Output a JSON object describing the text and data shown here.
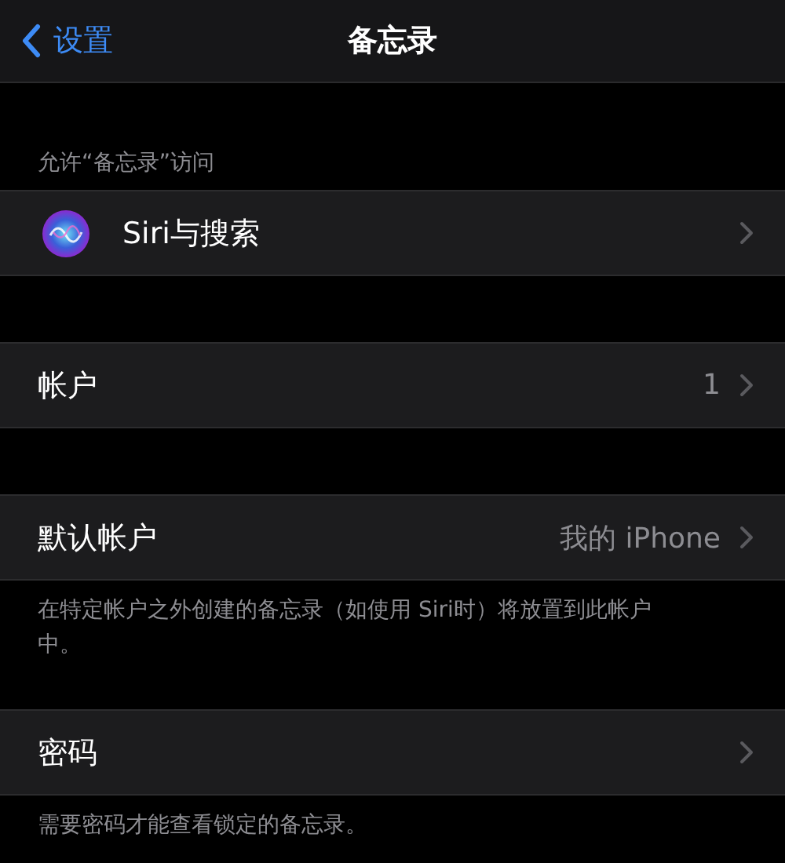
{
  "nav_bar": {
    "back_label": "设置",
    "title": "备忘录"
  },
  "sections": [
    {
      "header": "允许“备忘录”访问",
      "rows": [
        {
          "kind": "siri",
          "label": "Siri与搜索"
        }
      ]
    },
    {
      "rows": [
        {
          "kind": "plain",
          "label": "帐户",
          "value": "1"
        }
      ]
    },
    {
      "rows": [
        {
          "kind": "plain",
          "label": "默认帐户",
          "value": "我的 iPhone"
        }
      ],
      "footer": "在特定帐户之外创建的备忘录（如使用 Siri时）将放置到此帐户中。"
    },
    {
      "rows": [
        {
          "kind": "plain",
          "label": "密码"
        }
      ],
      "footer": "需要密码才能查看锁定的备忘录。"
    }
  ]
}
